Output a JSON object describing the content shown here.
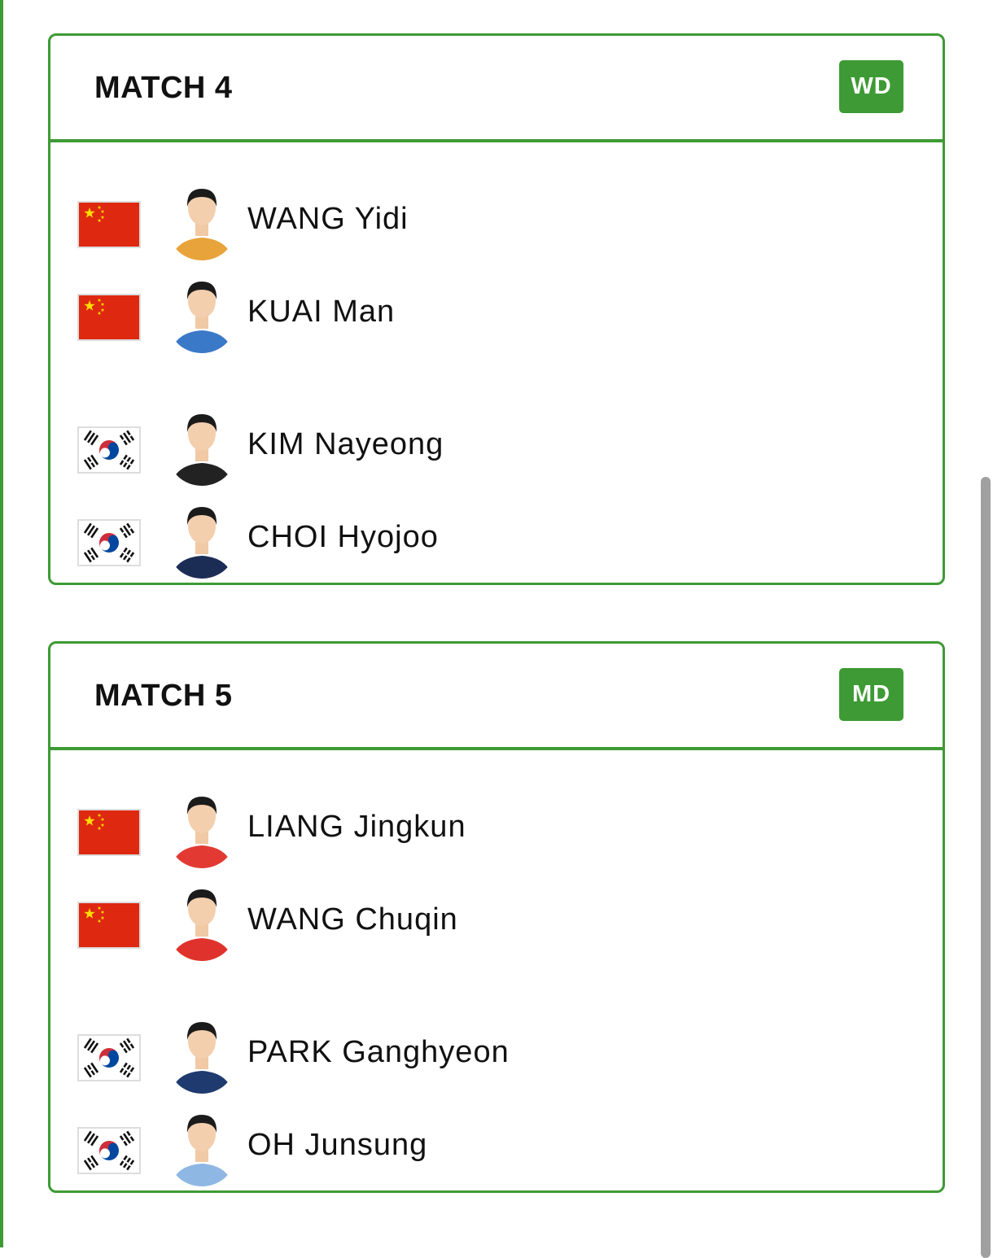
{
  "colors": {
    "accent": "#3e9a34",
    "china_red": "#de2910",
    "china_yellow": "#ffde00",
    "korea_red": "#cd2e3a",
    "korea_blue": "#0047a0"
  },
  "matches": [
    {
      "title": "MATCH 4",
      "badge": "WD",
      "players": [
        {
          "name": "WANG Yidi",
          "flag": "china-flag-icon",
          "avatar": "player-avatar"
        },
        {
          "name": "KUAI Man",
          "flag": "china-flag-icon",
          "avatar": "player-avatar"
        },
        {
          "name": "KIM Nayeong",
          "flag": "korea-flag-icon",
          "avatar": "player-avatar"
        },
        {
          "name": "CHOI Hyojoo",
          "flag": "korea-flag-icon",
          "avatar": "player-avatar"
        }
      ]
    },
    {
      "title": "MATCH 5",
      "badge": "MD",
      "players": [
        {
          "name": "LIANG Jingkun",
          "flag": "china-flag-icon",
          "avatar": "player-avatar"
        },
        {
          "name": "WANG Chuqin",
          "flag": "china-flag-icon",
          "avatar": "player-avatar"
        },
        {
          "name": "PARK Ganghyeon",
          "flag": "korea-flag-icon",
          "avatar": "player-avatar"
        },
        {
          "name": "OH Junsung",
          "flag": "korea-flag-icon",
          "avatar": "player-avatar"
        }
      ]
    }
  ]
}
